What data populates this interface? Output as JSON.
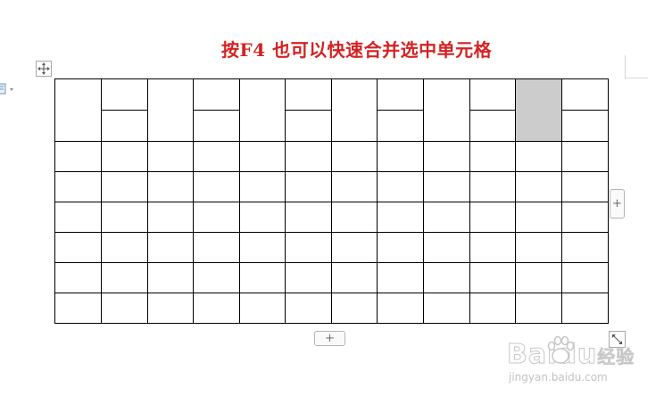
{
  "caption": "按F4 也可以快速合并选中单元格",
  "table": {
    "columns": 12,
    "body_rows": 6,
    "selected_cell": {
      "column": 11,
      "row": 1
    }
  },
  "controls": {
    "add_column_symbol": "+",
    "add_row_symbol": "+"
  },
  "watermark": {
    "logo": "Baidu",
    "logo_suffix": "经验",
    "url": "jingyan.baidu.com"
  },
  "icons": {
    "move_handle": "move-arrows-icon",
    "resize_handle": "diagonal-resize-icon",
    "paste_options": "document-icon"
  },
  "colors": {
    "caption": "#d42222",
    "selected_cell": "#cccccc",
    "border": "#000000"
  }
}
